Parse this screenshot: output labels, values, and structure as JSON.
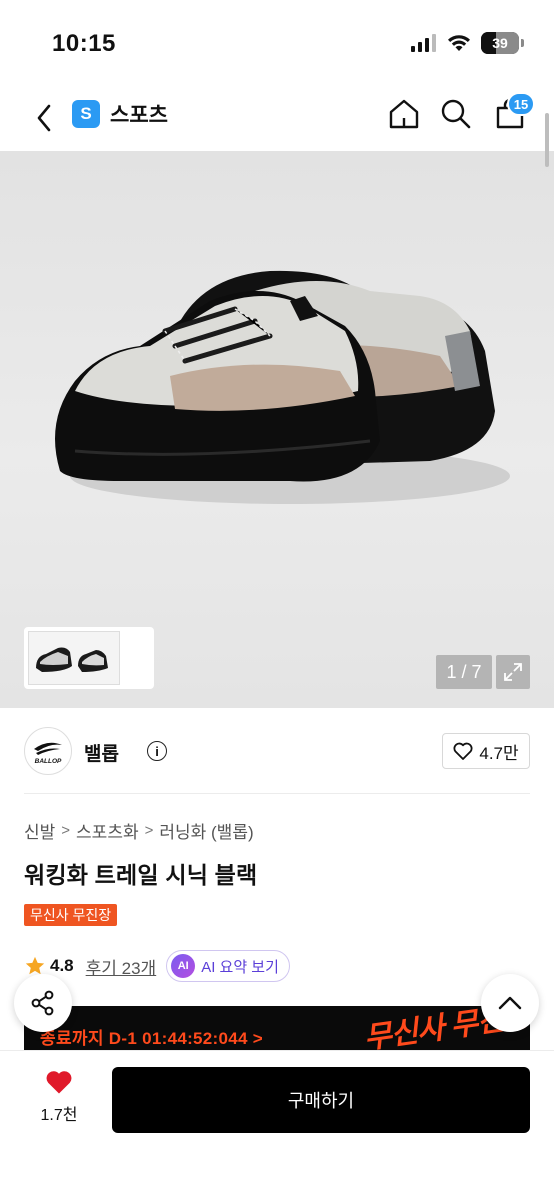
{
  "status_bar": {
    "time": "10:15",
    "battery": "39"
  },
  "nav": {
    "category_badge": "S",
    "category_title": "스포츠",
    "cart_count": "15"
  },
  "gallery": {
    "page_indicator": "1 / 7"
  },
  "brand": {
    "name": "밸롭",
    "logo_text": "BALLOP",
    "like_count": "4.7만"
  },
  "breadcrumb": [
    "신발",
    "스포츠화",
    "러닝화 (밸롭)"
  ],
  "product": {
    "title": "워킹화 트레일 시닉 블랙",
    "tag": "무신사 무진장"
  },
  "rating": {
    "score": "4.8",
    "reviews": "후기 23개",
    "ai_badge": "AI",
    "ai_label": "AI 요약 보기"
  },
  "promo": {
    "countdown": "종료까지 D-1 01:44:52:044 >",
    "art_text": "무신사 무진장"
  },
  "bottom_bar": {
    "like_count": "1.7천",
    "buy_label": "구매하기"
  },
  "colors": {
    "accent": "#2b9af3",
    "promo": "#ff4a1c",
    "tag": "#ef5521",
    "heart": "#e0192a",
    "buy": "#000000"
  }
}
